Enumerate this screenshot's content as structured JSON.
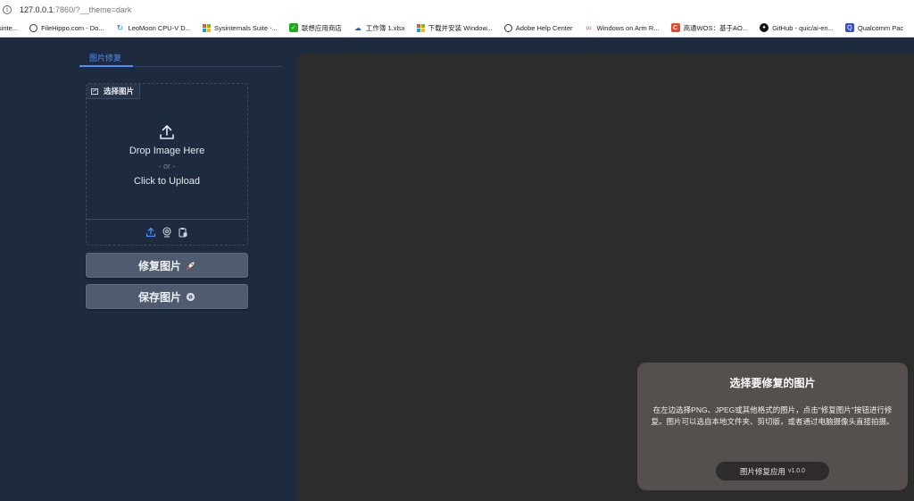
{
  "browser": {
    "url_host": "127.0.0.1",
    "url_rest": ":7860/?__theme=dark",
    "bookmarks": [
      {
        "label": "sinte...",
        "icon": "none"
      },
      {
        "label": "FileHippo.com - Do...",
        "icon": "globe-icon"
      },
      {
        "label": "LeoMoon CPU-V D...",
        "icon": "leomoon-icon"
      },
      {
        "label": "Sysinternals Suite -...",
        "icon": "windows-icon"
      },
      {
        "label": "联想应用商店",
        "icon": "lenovo-store-icon"
      },
      {
        "label": "工作簿 1.xlsx",
        "icon": "onedrive-icon"
      },
      {
        "label": "下载并安装 Window...",
        "icon": "windows-icon"
      },
      {
        "label": "Adobe Help Center",
        "icon": "globe-icon"
      },
      {
        "label": "Windows on Arm R...",
        "icon": "link-icon"
      },
      {
        "label": "高通WOS：基于AO...",
        "icon": "csdn-icon"
      },
      {
        "label": "GitHub - quic/ai-en...",
        "icon": "github-icon"
      },
      {
        "label": "Qualcomm Pac",
        "icon": "qualcomm-icon"
      }
    ]
  },
  "app": {
    "tab_label": "图片修复",
    "upload": {
      "badge_label": "选择图片",
      "drop_text": "Drop Image Here",
      "or_text": "- or -",
      "click_text": "Click to Upload"
    },
    "repair_button": "修复图片",
    "save_button": "保存图片",
    "notice": {
      "title": "选择要修复的图片",
      "description": "在左边选择PNG、JPEG或其他格式的图片，点击\"修复图片\"按钮进行修复。图片可以选自本地文件夹、剪切版，或者通过电脑摄像头直接拍摄。",
      "app_name": "图片修复应用",
      "version": "v1.0.0"
    }
  },
  "colors": {
    "background": "#1e2a3e",
    "accent": "#4a8fff",
    "canvas": "#2c2c2c",
    "notice": "#554f4d"
  }
}
